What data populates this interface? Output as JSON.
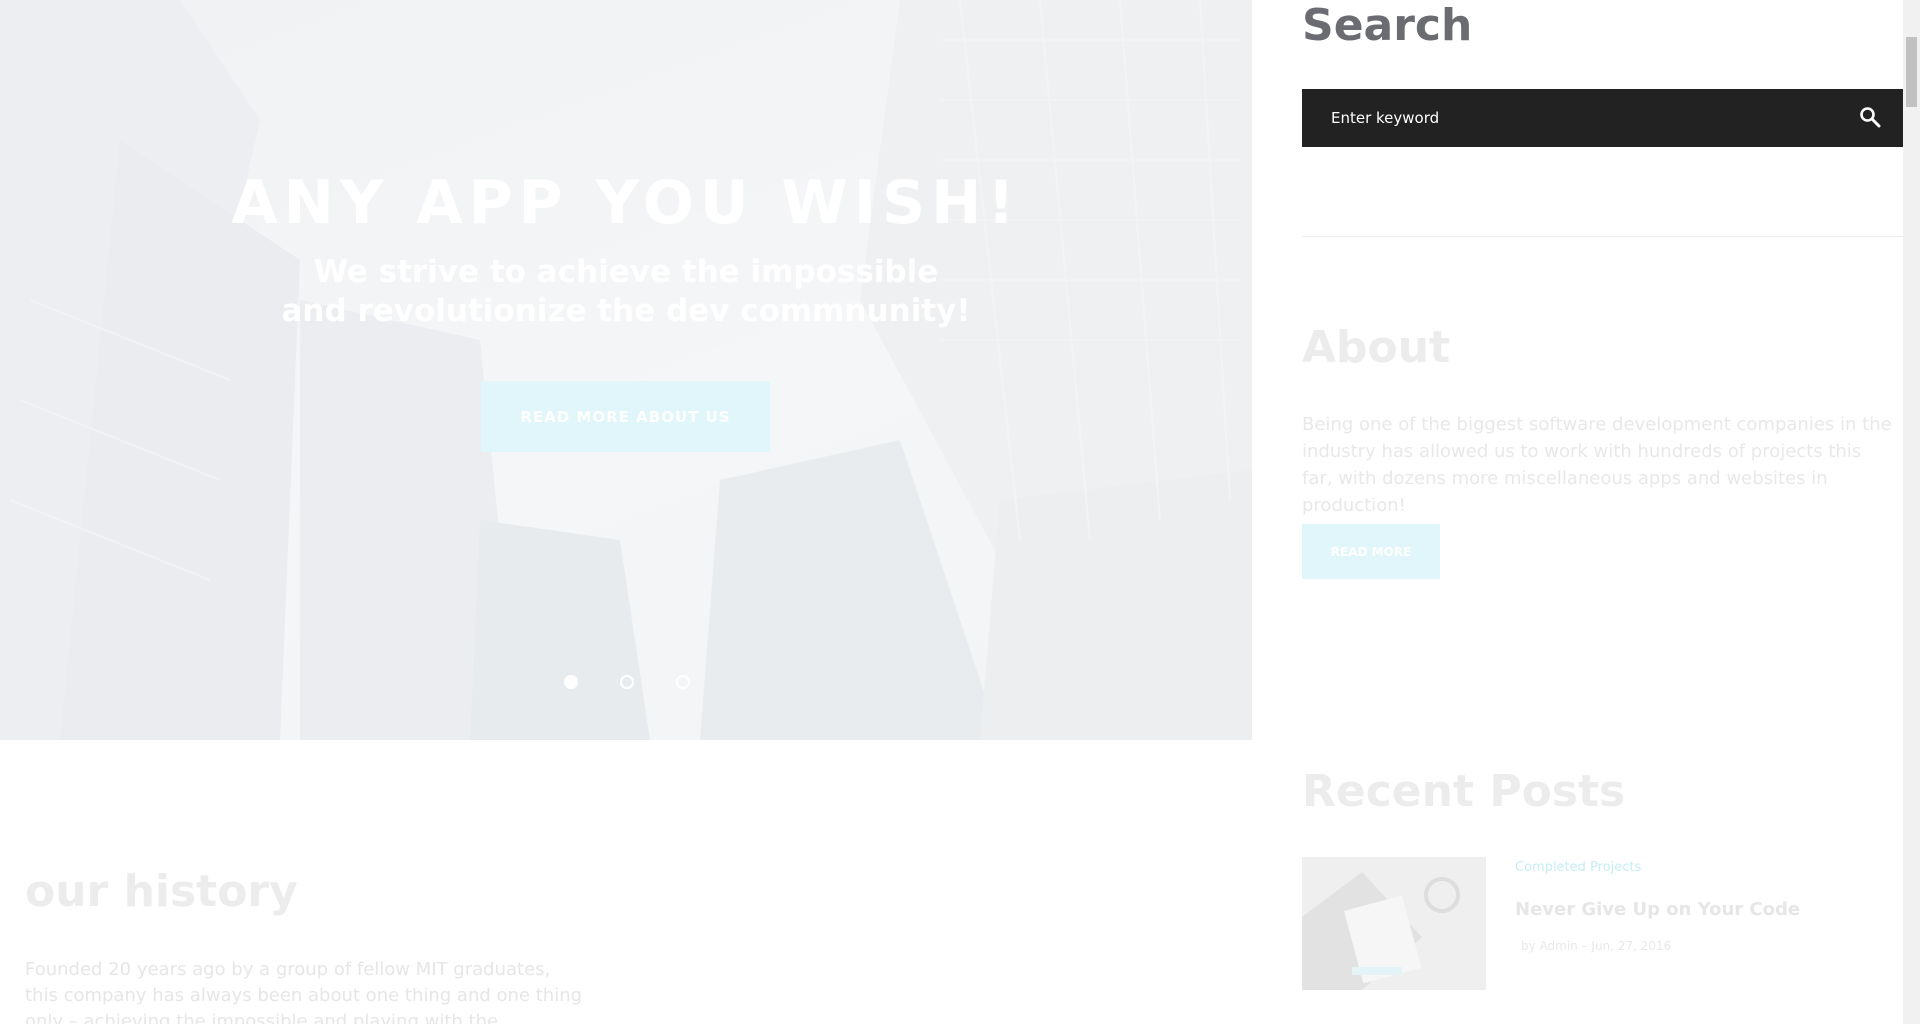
{
  "hero": {
    "title": "ANY APP YOU WISH!",
    "subtitle_line1": "We strive to achieve the impossible",
    "subtitle_line2": "and revolutionize the dev commnunity!",
    "button_label": "READ MORE ABOUT US",
    "slides": 3,
    "active_slide": 1
  },
  "history": {
    "title": "our history",
    "text": "Founded 20 years ago by a group of fellow MIT graduates, this company has always been about one thing and one thing only – achieving the impossible and playing with the technology to"
  },
  "sidebar": {
    "search": {
      "title": "Search",
      "placeholder": "Enter keyword"
    },
    "about": {
      "title": "About",
      "text": "Being one of the biggest software development companies in the industry has allowed us to work with hundreds of projects this far, with dozens more miscellaneous apps and websites in production!",
      "button_label": "READ MORE"
    },
    "recent_posts": {
      "title": "Recent Posts",
      "items": [
        {
          "category": "Completed Projects",
          "title": "Never Give Up on Your Code",
          "meta": "by Admin – Jun, 27, 2016"
        }
      ]
    }
  },
  "colors": {
    "accent": "#e0f6fa",
    "search_bg": "#222222",
    "heading_dark": "#6a6c72"
  }
}
